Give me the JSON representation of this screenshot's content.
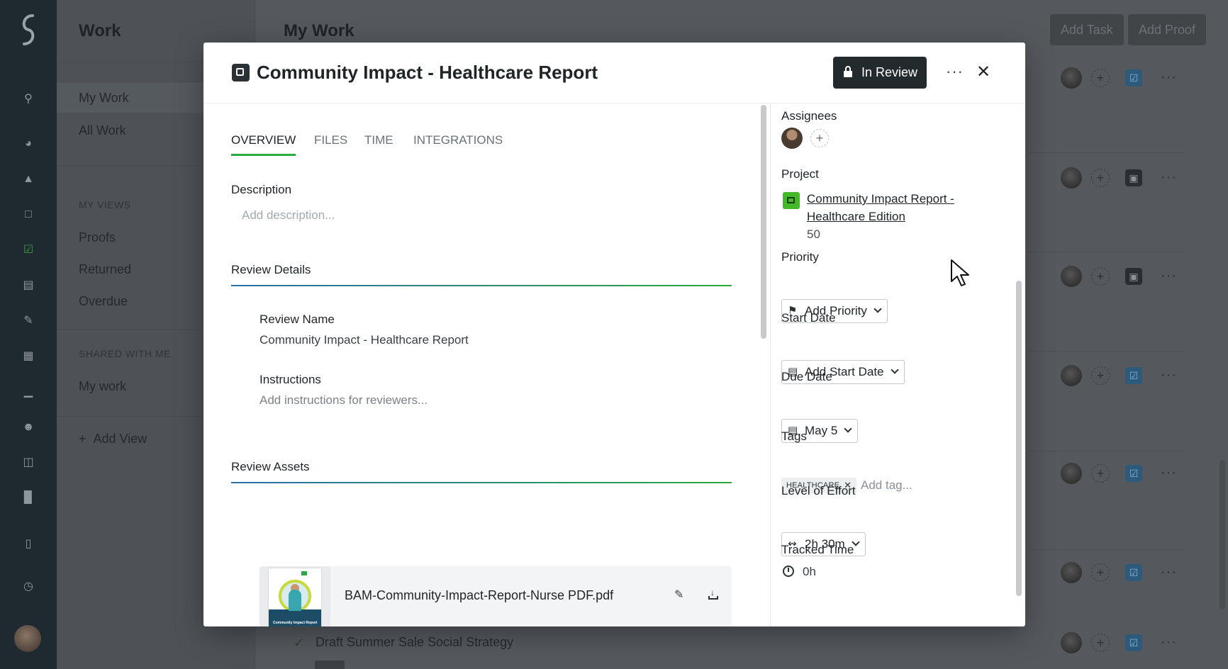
{
  "workspace": {
    "title": "Work",
    "nav": [
      "My Work",
      "All Work"
    ],
    "my_views_header": "MY VIEWS",
    "my_views": [
      "Proofs",
      "Returned",
      "Overdue"
    ],
    "shared_header": "SHARED WITH ME",
    "shared": [
      "My work"
    ],
    "add_view": "Add View"
  },
  "main": {
    "title": "My Work",
    "add_task": "Add Task",
    "add_proof": "Add Proof",
    "bottom_task": "Draft Summer Sale Social Strategy"
  },
  "modal": {
    "title": "Community Impact - Healthcare Report",
    "status": "In Review",
    "tabs": [
      "OVERVIEW",
      "FILES",
      "TIME",
      "INTEGRATIONS"
    ],
    "description_label": "Description",
    "description_placeholder": "Add description...",
    "review_details_label": "Review Details",
    "review_name_label": "Review Name",
    "review_name": "Community Impact - Healthcare Report",
    "instructions_label": "Instructions",
    "instructions_placeholder": "Add instructions for reviewers...",
    "review_assets_label": "Review Assets",
    "asset": {
      "file_name": "BAM-Community-Impact-Report-Nurse PDF.pdf",
      "thumb_text": "Community Impact Report"
    },
    "sidebar": {
      "assignees_label": "Assignees",
      "project_label": "Project",
      "project_name": "Community Impact Report - Healthcare Edition",
      "project_number": "50",
      "priority_label": "Priority",
      "priority_value": "Add Priority",
      "start_date_label": "Start Date",
      "start_date_value": "Add Start Date",
      "due_date_label": "Due Date",
      "due_date_value": "May 5",
      "tags_label": "Tags",
      "tags": [
        "HEALTHCARE"
      ],
      "tag_placeholder": "Add tag...",
      "effort_label": "Level of Effort",
      "effort_value": "2h 30m",
      "tracked_label": "Tracked Time",
      "tracked_value": "0h"
    }
  },
  "colors": {
    "accent_green": "#2aa940",
    "accent_blue": "#2b6fa8",
    "status_dark": "#232a2e",
    "project_green": "#43b92a"
  }
}
